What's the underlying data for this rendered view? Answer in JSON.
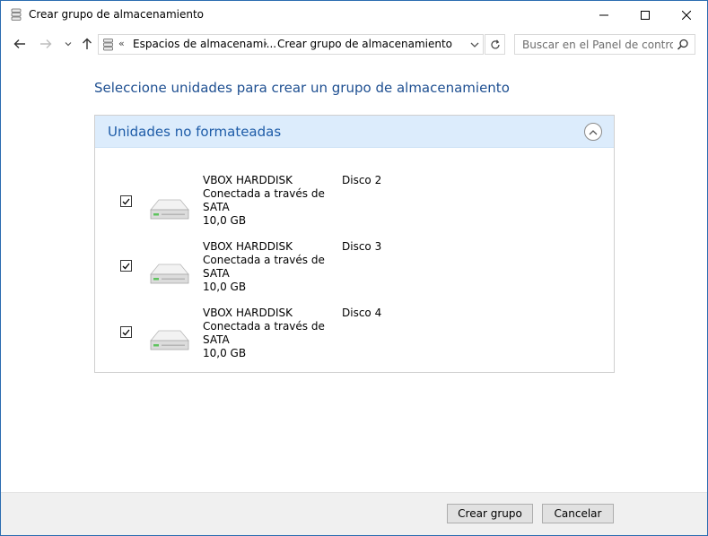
{
  "window": {
    "title": "Crear grupo de almacenamiento"
  },
  "address": {
    "crumbs": [
      "Espacios de almacenami...",
      "Crear grupo de almacenamiento"
    ],
    "chevron": "«",
    "separator": "›"
  },
  "search": {
    "placeholder": "Buscar en el Panel de control"
  },
  "main": {
    "heading": "Seleccione unidades para crear un grupo de almacenamiento",
    "panel_title": "Unidades no formateadas",
    "drives": [
      {
        "name": "VBOX HARDDISK",
        "connection": "Conectada a través de SATA",
        "size": "10,0 GB",
        "disk": "Disco 2",
        "checked": true
      },
      {
        "name": "VBOX HARDDISK",
        "connection": "Conectada a través de SATA",
        "size": "10,0 GB",
        "disk": "Disco 3",
        "checked": true
      },
      {
        "name": "VBOX HARDDISK",
        "connection": "Conectada a través de SATA",
        "size": "10,0 GB",
        "disk": "Disco 4",
        "checked": true
      }
    ]
  },
  "footer": {
    "create_label": "Crear grupo",
    "cancel_label": "Cancelar"
  },
  "colors": {
    "heading": "#1e4f91",
    "panel_header_bg": "#dcecfc",
    "panel_title": "#1e5ca8"
  }
}
